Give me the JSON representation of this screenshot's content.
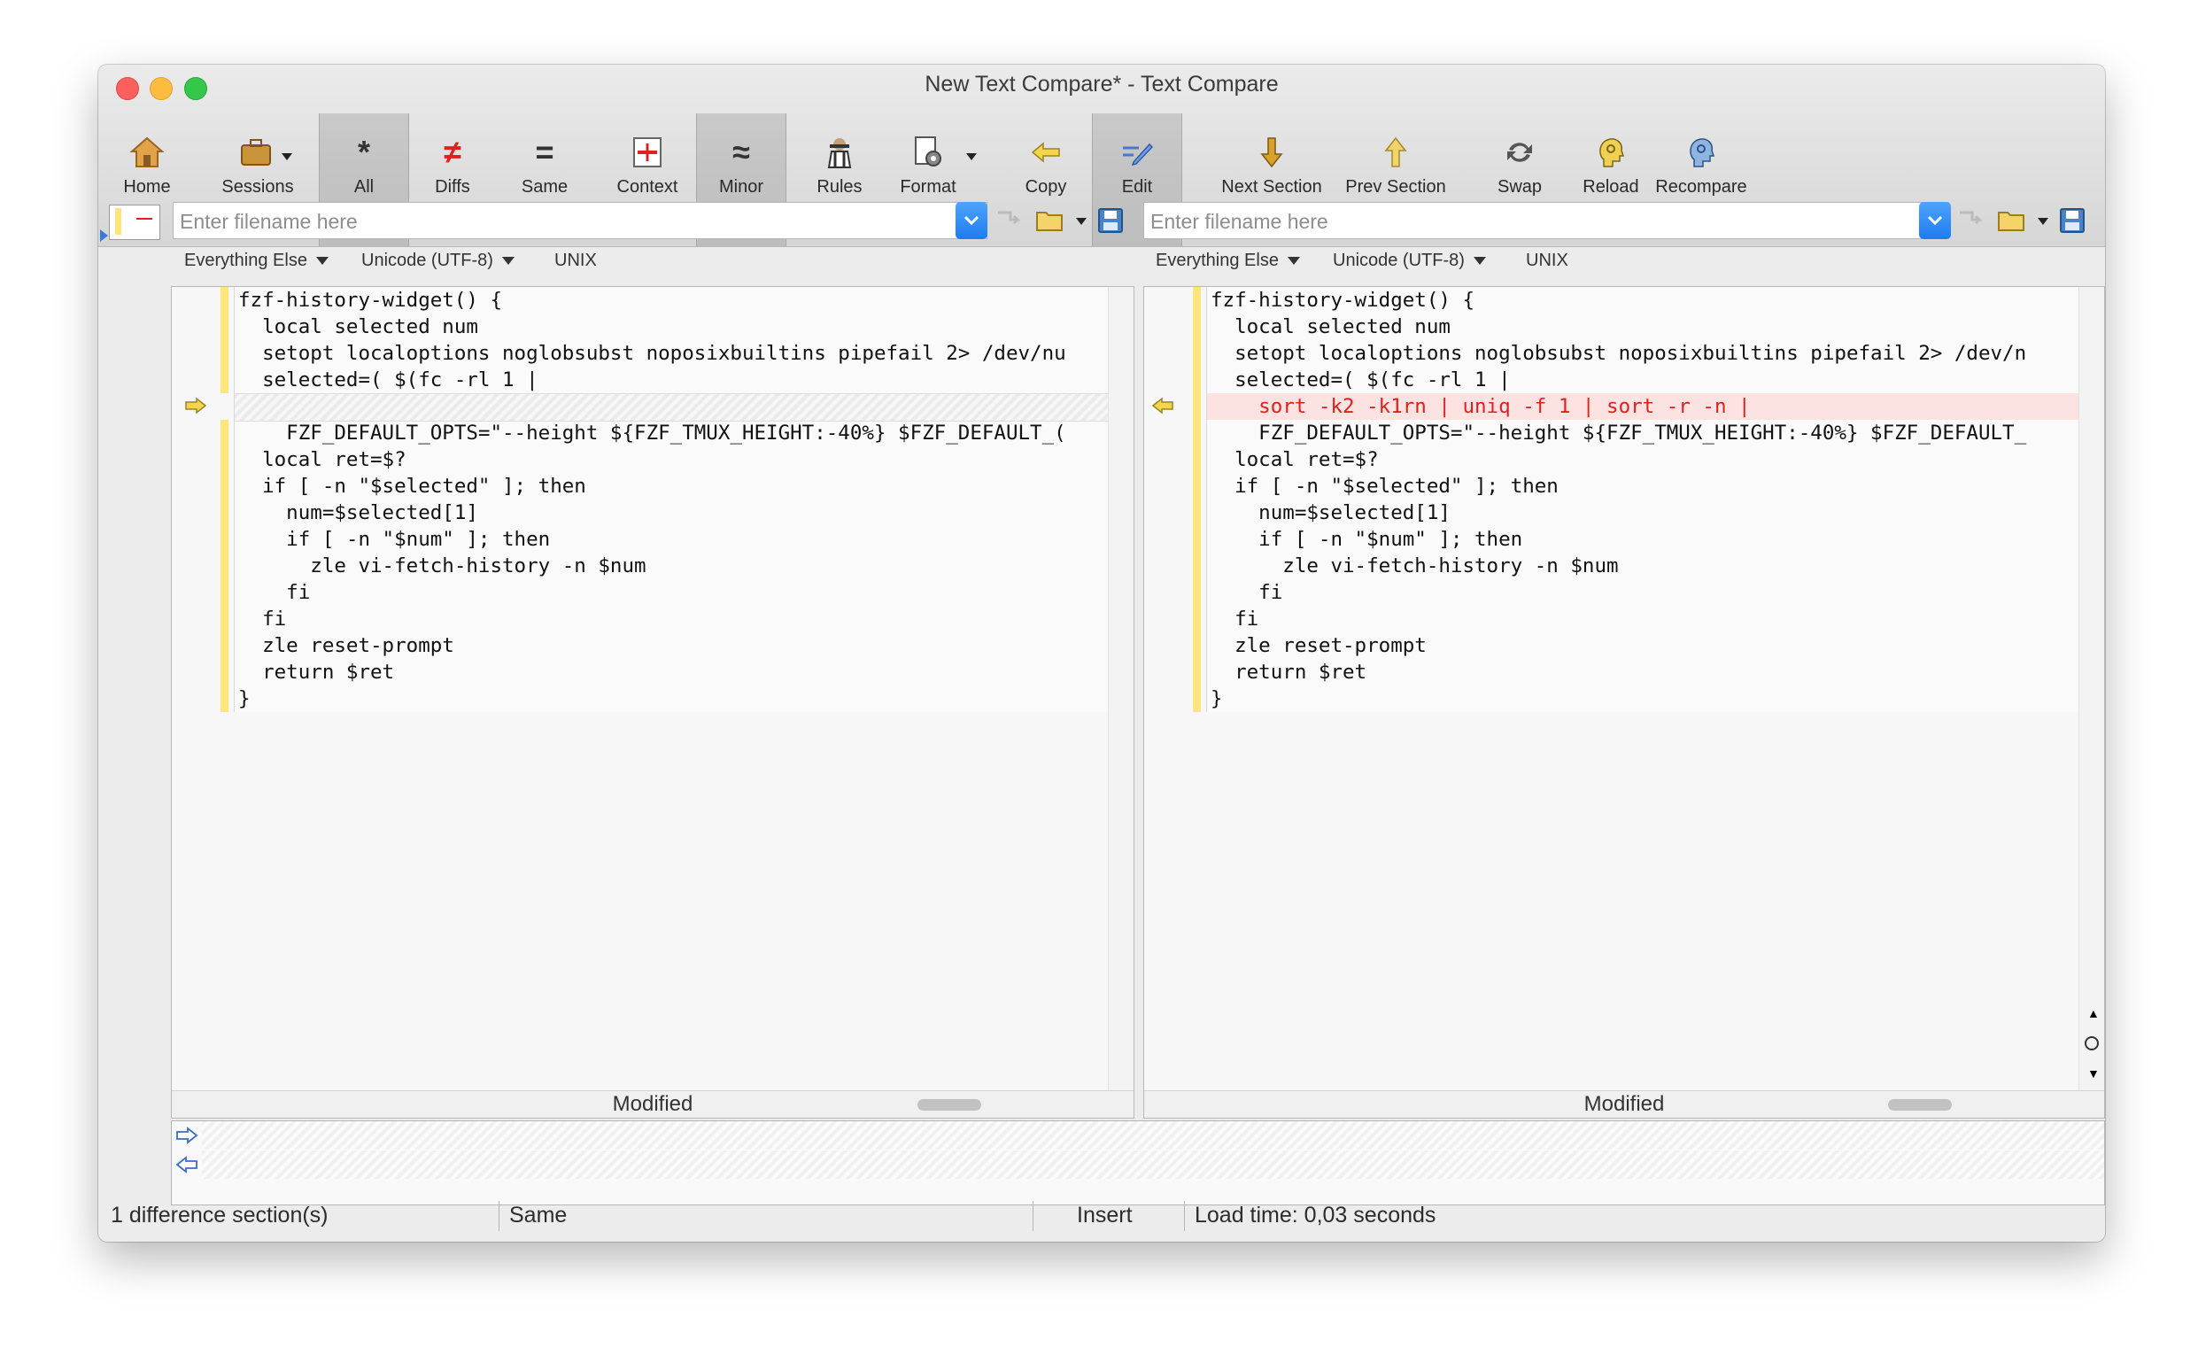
{
  "window": {
    "title": "New Text Compare* - Text Compare"
  },
  "toolbar": {
    "home": "Home",
    "sessions": "Sessions",
    "all": "All",
    "diffs": "Diffs",
    "same": "Same",
    "context": "Context",
    "minor": "Minor",
    "rules": "Rules",
    "format": "Format",
    "copy": "Copy",
    "edit": "Edit",
    "next_section": "Next Section",
    "prev_section": "Prev Section",
    "swap": "Swap",
    "reload": "Reload",
    "recompare": "Recompare"
  },
  "left": {
    "filename_placeholder": "Enter filename here",
    "format": "Everything Else",
    "encoding": "Unicode (UTF-8)",
    "line_endings": "UNIX",
    "status": "Modified",
    "lines": [
      "fzf-history-widget() {",
      "  local selected num",
      "  setopt localoptions noglobsubst noposixbuiltins pipefail 2> /dev/nu",
      "  selected=( $(fc -rl 1 |",
      "",
      "    FZF_DEFAULT_OPTS=\"--height ${FZF_TMUX_HEIGHT:-40%} $FZF_DEFAULT_(",
      "  local ret=$?",
      "  if [ -n \"$selected\" ]; then",
      "    num=$selected[1]",
      "    if [ -n \"$num\" ]; then",
      "      zle vi-fetch-history -n $num",
      "    fi",
      "  fi",
      "  zle reset-prompt",
      "  return $ret",
      "}"
    ]
  },
  "right": {
    "filename_placeholder": "Enter filename here",
    "format": "Everything Else",
    "encoding": "Unicode (UTF-8)",
    "line_endings": "UNIX",
    "status": "Modified",
    "lines": [
      "fzf-history-widget() {",
      "  local selected num",
      "  setopt localoptions noglobsubst noposixbuiltins pipefail 2> /dev/n",
      "  selected=( $(fc -rl 1 |",
      "    sort -k2 -k1rn | uniq -f 1 | sort -r -n |",
      "    FZF_DEFAULT_OPTS=\"--height ${FZF_TMUX_HEIGHT:-40%} $FZF_DEFAULT_",
      "  local ret=$?",
      "  if [ -n \"$selected\" ]; then",
      "    num=$selected[1]",
      "    if [ -n \"$num\" ]; then",
      "      zle vi-fetch-history -n $num",
      "    fi",
      "  fi",
      "  zle reset-prompt",
      "  return $ret",
      "}"
    ]
  },
  "statusbar": {
    "differences": "1 difference section(s)",
    "state": "Same",
    "mode": "Insert",
    "load_time": "Load time: 0,03 seconds"
  },
  "colors": {
    "diff_background": "#fde2e2",
    "diff_text": "#e0201b",
    "change_bar": "#ffe57a"
  }
}
